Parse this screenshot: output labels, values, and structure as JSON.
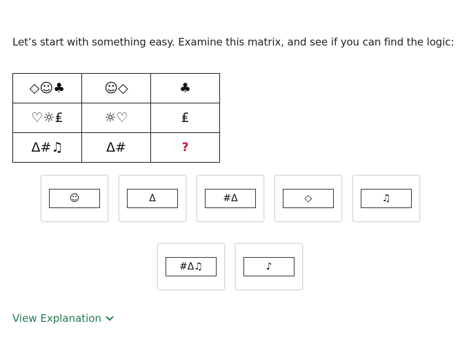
{
  "prompt": "Let’s start with something easy. Examine this matrix, and see if you can find the logic:",
  "matrix": {
    "rows": [
      [
        "◇☺♣",
        "☺◇",
        "♣"
      ],
      [
        "♡☼₤",
        "☼♡",
        "₤"
      ],
      [
        "Δ#♫",
        "Δ#",
        "?"
      ]
    ]
  },
  "options": [
    "☺",
    "Δ",
    "#Δ",
    "◇",
    "♫",
    "#Δ♫",
    "♪"
  ],
  "explanation_link": "View Explanation",
  "icons": {
    "explanation": "chevron-down-icon"
  },
  "colors": {
    "accent": "#1f7a4c",
    "question_mark": "#c8102e"
  }
}
